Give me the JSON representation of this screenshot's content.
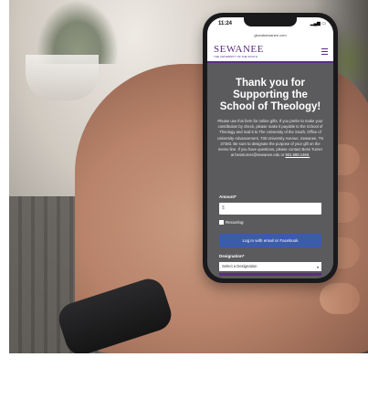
{
  "phone": {
    "time": "11:24",
    "url": "giveatsewanee.com",
    "logo": "SEWANEE",
    "logo_sub": "THE UNIVERSITY OF THE SOUTH",
    "title": "Thank you for Supporting the School of Theology!",
    "body": "Please use this form for online gifts. If you prefer to make your contribution by check, please make it payable to the School of Theology and mail it to The University of the South, Office of University Advancement, 735 University Avenue, Sewanee, TN 37383. Be sure to designate the purpose of your gift on the memo line. If you have questions, please contact Bess Turner at bessturner@sewanee.edu or",
    "phone_link": "931.598.1460.",
    "amount_label": "Amount*",
    "amount_prefix": "$",
    "recurring_label": "Recurring",
    "login_button": "Log in with email or Facebook",
    "designation_label": "Designation*",
    "designation_value": "Select a Designation"
  }
}
